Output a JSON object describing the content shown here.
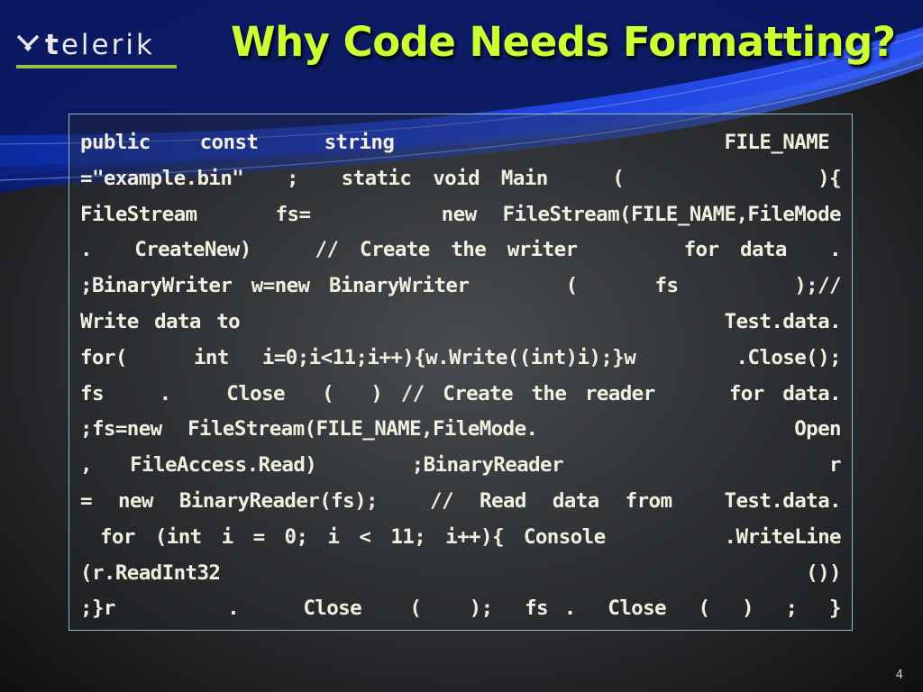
{
  "logo": {
    "text_prefix": "t",
    "text_rest": "elerik",
    "accent_color": "#8cc63f"
  },
  "slide": {
    "title": "Why Code Needs Formatting?",
    "title_color": "#ccff33",
    "number": "4"
  },
  "code": {
    "lines": [
      "public   const    string                    FILE_NAME ",
      "=\"example.bin\"  ;  static void Main   (         ){",
      "FileStream   fs=     new FileStream(FILE_NAME,FileMode",
      ".  CreateNew)   // Create the writer     for data  .",
      ";BinaryWriter w=new BinaryWriter     (    fs      );//",
      "Write data to                               Test.data.",
      "for(  int i=0;i<11;i++){w.Write((int)i);}w   .Close();",
      "fs   .   Close  (  ) // Create the reader    for data.",
      ";fs=new FileStream(FILE_NAME,FileMode.          Open",
      ",  FileAccess.Read)     ;BinaryReader              r",
      "= new BinaryReader(fs);  // Read data from  Test.data.",
      " for (int i = 0; i < 11; i++){ Console      .WriteLine",
      "(r.ReadInt32                                      ())",
      ";}r       .    Close   (   );  fs .  Close  (  )  ;  }"
    ]
  }
}
